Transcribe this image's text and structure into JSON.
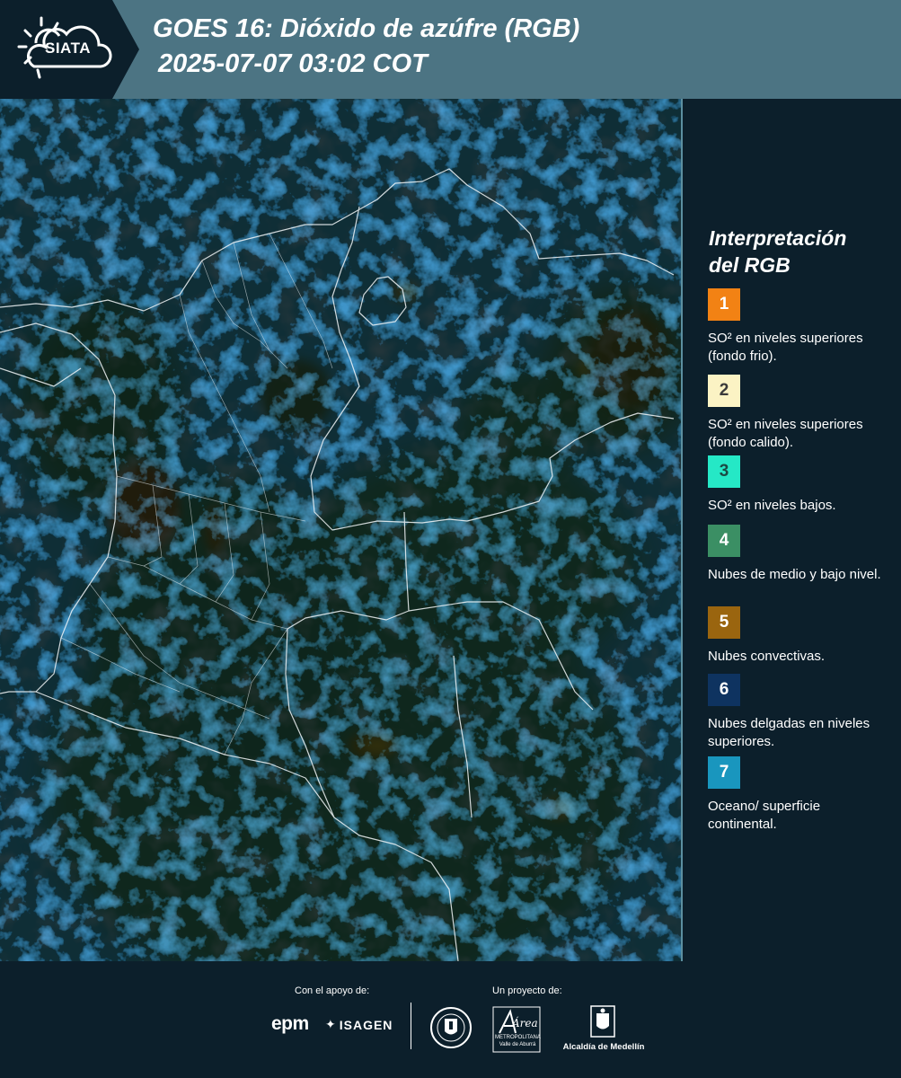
{
  "header": {
    "logo_text": "SIATA",
    "title_line1": "GOES 16: Dióxido de azúfre (RGB)",
    "title_line2": "2025-07-07 03:02 COT"
  },
  "legend": {
    "title_line1": "Interpretación",
    "title_line2": "del RGB",
    "items": [
      {
        "number": "1",
        "color": "#f28214",
        "text_color": "#ffffff",
        "label": "SO² en niveles superiores (fondo frio)."
      },
      {
        "number": "2",
        "color": "#fbf3c4",
        "text_color": "#3a3a3a",
        "label": "SO² en niveles superiores (fondo calido)."
      },
      {
        "number": "3",
        "color": "#25e8c6",
        "text_color": "#1b4a44",
        "label": "SO² en niveles bajos."
      },
      {
        "number": "4",
        "color": "#3b8f64",
        "text_color": "#ffffff",
        "label": "Nubes de medio y bajo nivel."
      },
      {
        "number": "5",
        "color": "#9a650f",
        "text_color": "#ffffff",
        "label": "Nubes convectivas."
      },
      {
        "number": "6",
        "color": "#0e3360",
        "text_color": "#ffffff",
        "label": "Nubes delgadas en niveles superiores."
      },
      {
        "number": "7",
        "color": "#1996be",
        "text_color": "#ffffff",
        "label": "Oceano/ superficie continental."
      }
    ]
  },
  "footer": {
    "support_label": "Con el apoyo de:",
    "project_label": "Un proyecto de:",
    "sponsor_epm": "epm",
    "sponsor_isagen": "ISAGEN",
    "area_name": "Área",
    "area_subtitle1": "METROPOLITANA",
    "area_subtitle2": "Valle de Aburrá",
    "alcaldia": "Alcaldía de Medellín"
  },
  "colors": {
    "header_bg": "#4c7483",
    "panel_bg": "#0c1f2b"
  }
}
